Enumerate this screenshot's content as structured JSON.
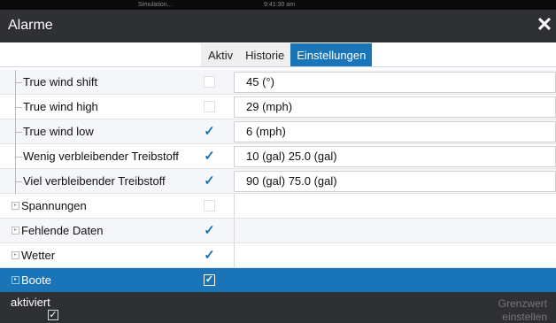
{
  "statusbar": {
    "simulation": "Simulation...",
    "time": "9:41:30 am"
  },
  "window": {
    "title": "Alarme",
    "close_icon": "close-icon"
  },
  "tabs": [
    {
      "label": "Aktiv",
      "active": false
    },
    {
      "label": "Historie",
      "active": false
    },
    {
      "label": "Einstellungen",
      "active": true
    }
  ],
  "rows": [
    {
      "label": "True wind shift",
      "checked": false,
      "value": "45 (°)",
      "type": "child"
    },
    {
      "label": "True wind high",
      "checked": false,
      "value": "29 (mph)",
      "type": "child"
    },
    {
      "label": "True wind low",
      "checked": true,
      "value": "6 (mph)",
      "type": "child"
    },
    {
      "label": "Wenig verbleibender Treibstoff",
      "checked": true,
      "value": "10 (gal)  25.0 (gal)",
      "type": "child"
    },
    {
      "label": "Viel verbleibender Treibstoff",
      "checked": true,
      "value": "90 (gal)  75.0 (gal)",
      "type": "child"
    },
    {
      "label": "Spannungen",
      "checked": false,
      "type": "group"
    },
    {
      "label": "Fehlende Daten",
      "checked": true,
      "type": "group"
    },
    {
      "label": "Wetter",
      "checked": true,
      "type": "group"
    },
    {
      "label": "Boote",
      "checked": true,
      "type": "group",
      "selected": true
    }
  ],
  "bottom": {
    "left_label": "aktiviert",
    "left_checked": true,
    "right_line1": "Grenzwert",
    "right_line2": "einstellen"
  },
  "colors": {
    "accent": "#1a75b8",
    "titlebar": "#2e3033",
    "statusbar": "#0a0a0a"
  }
}
